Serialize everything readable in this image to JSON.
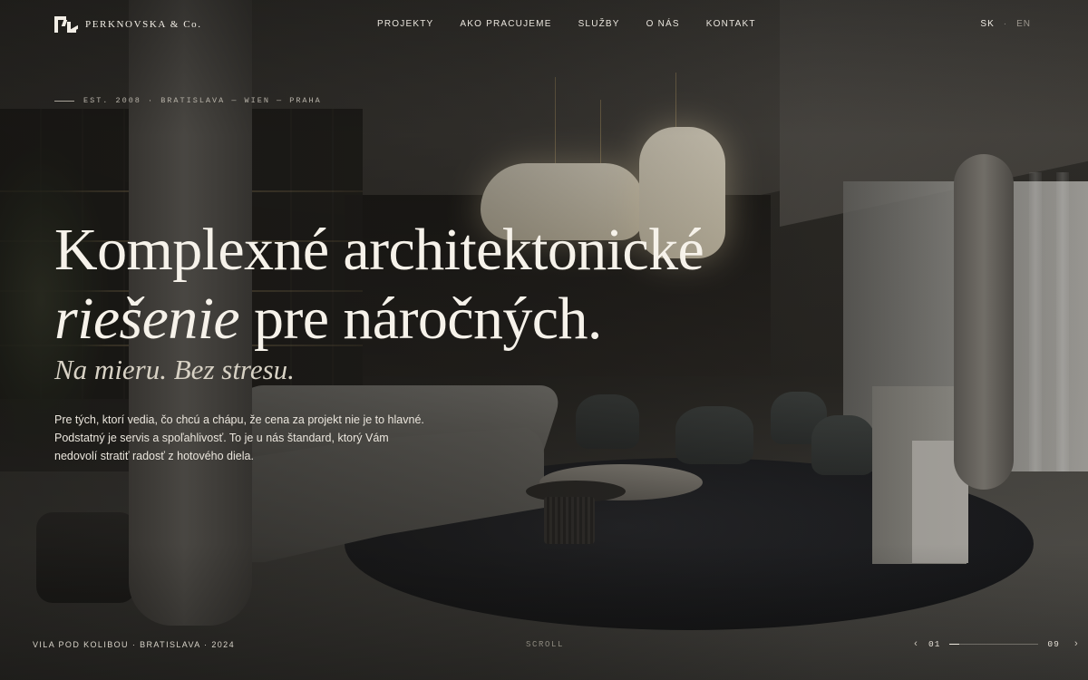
{
  "brand": {
    "name": "PERKNOVSKA & Co.",
    "logo_icon": "pk-monogram-logo"
  },
  "nav": {
    "items": [
      "PROJEKTY",
      "AKO PRACUJEME",
      "SLUŽBY",
      "O NÁS",
      "KONTAKT"
    ]
  },
  "lang": {
    "active": "SK",
    "separator": "·",
    "other": "EN"
  },
  "hero": {
    "eyebrow": "EST. 2008 · BRATISLAVA — WIEN — PRAHA",
    "headline_line1": "Komplexné architektonické",
    "headline_em": "riešenie",
    "headline_rest": " pre náročných.",
    "tagline": "Na mieru. Bez stresu.",
    "intro": "Pre tých, ktorí vedia, čo chcú a chápu, že cena za projekt nie je to hlavné. Podstatný je servis a spoľahlivosť. To je u nás štandard, ktorý Vám nedovolí stratiť radosť z hotového diela."
  },
  "footer": {
    "caption": "VILA POD KOLIBOU · BRATISLAVA · 2024",
    "scroll": "SCROLL",
    "pager": {
      "current": "01",
      "total": "09",
      "progress": 0.11,
      "prev_icon": "chevron-left-icon",
      "next_icon": "chevron-right-icon"
    }
  },
  "colors": {
    "text": "#f2eee6",
    "muted": "#b8b3a9",
    "overlay": "#0f0e0c"
  }
}
